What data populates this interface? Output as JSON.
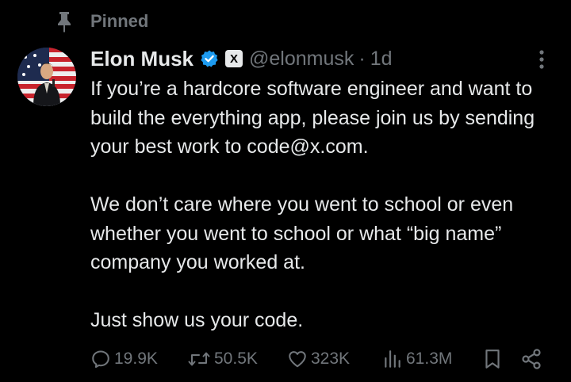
{
  "pinned": {
    "label": "Pinned"
  },
  "author": {
    "name": "Elon Musk",
    "handle": "@elonmusk",
    "separator": "·",
    "time": "1d",
    "affiliate_badge": "X",
    "verified_color": "#1d9bf0"
  },
  "tweet": {
    "paragraphs": [
      "If you’re a hardcore software engineer and want to build the everything app, please join us by sending your best work to code@x.com.",
      "We don’t care where you went to school or even whether you went to school or what “big name” company you worked at.",
      "Just show us your code."
    ]
  },
  "actions": {
    "reply": {
      "icon": "reply-icon",
      "count": "19.9K"
    },
    "retweet": {
      "icon": "retweet-icon",
      "count": "50.5K"
    },
    "like": {
      "icon": "heart-icon",
      "count": "323K"
    },
    "views": {
      "icon": "views-icon",
      "count": "61.3M"
    },
    "bookmark": {
      "icon": "bookmark-icon"
    },
    "share": {
      "icon": "share-icon"
    }
  },
  "colors": {
    "background": "#000000",
    "text": "#e7e9ea",
    "secondary": "#71767b",
    "accent": "#1d9bf0"
  }
}
